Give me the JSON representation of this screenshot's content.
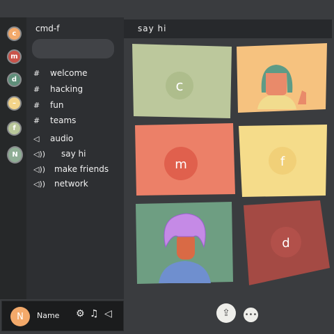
{
  "servers": [
    {
      "label": "c",
      "color": "#f3a96a"
    },
    {
      "label": "m",
      "color": "#c9534a"
    },
    {
      "label": "d",
      "color": "#5f8f7a"
    },
    {
      "label": "–",
      "color": "#f4d48a"
    },
    {
      "label": "f",
      "color": "#b9c79a"
    },
    {
      "label": "N",
      "color": "#8fae95"
    }
  ],
  "sidebar": {
    "title": "cmd-f",
    "text_channels": [
      "welcome",
      "hacking",
      "fun",
      "teams"
    ],
    "voice_channels": [
      "audio",
      "say hi",
      "make friends",
      "network"
    ]
  },
  "header": {
    "channel": "say hi"
  },
  "tiles": [
    {
      "label": "c",
      "color": "#bcc89c"
    },
    {
      "label": "",
      "color": "#f6c27f"
    },
    {
      "label": "m",
      "color": "#ec8068"
    },
    {
      "label": "f",
      "color": "#f5dc8a"
    },
    {
      "label": "",
      "color": "#6e9e82"
    },
    {
      "label": "d",
      "color": "#a44a44"
    }
  ],
  "user": {
    "name": "Name",
    "avatar": "N"
  }
}
